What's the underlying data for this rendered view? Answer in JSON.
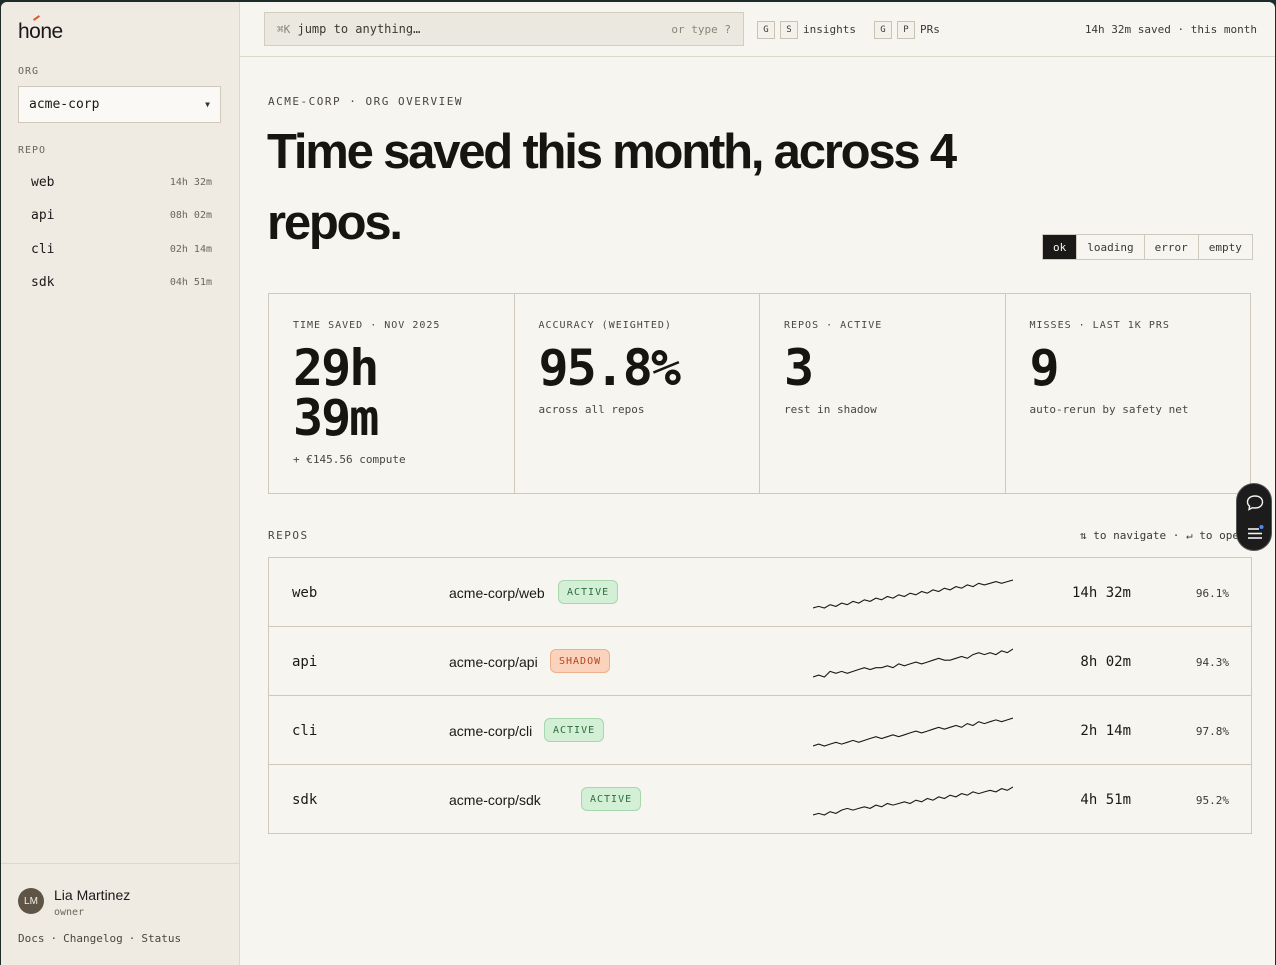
{
  "brand": {
    "name": "hone"
  },
  "sidebar": {
    "org_label": "ORG",
    "org_value": "acme-corp",
    "repo_label": "REPO",
    "repos": [
      {
        "name": "web",
        "time": "14h 32m"
      },
      {
        "name": "api",
        "time": "08h 02m"
      },
      {
        "name": "cli",
        "time": "02h 14m"
      },
      {
        "name": "sdk",
        "time": "04h 51m"
      }
    ],
    "user": {
      "initials": "LM",
      "name": "Lia Martinez",
      "role": "owner"
    },
    "footer_links": [
      "Docs",
      "·",
      "Changelog",
      "·",
      "Status"
    ]
  },
  "topbar": {
    "search_prefix": "⌘K",
    "search_placeholder": "jump to anything…",
    "search_hint": "or type ?",
    "shortcut_insights": {
      "keys": [
        "G",
        "S"
      ],
      "label": "insights"
    },
    "shortcut_prs": {
      "keys": [
        "G",
        "P"
      ],
      "label": "PRs"
    },
    "summary": "14h 32m saved · this month"
  },
  "main": {
    "eyebrow": "ACME-CORP · ORG OVERVIEW",
    "headline": "Time saved this month, across 4 repos.",
    "states": [
      "ok",
      "loading",
      "error",
      "empty"
    ],
    "active_state": "ok",
    "stats": [
      {
        "label": "TIME SAVED · NOV 2025",
        "value": "29h 39m",
        "sub": "+ €145.56 compute"
      },
      {
        "label": "ACCURACY (WEIGHTED)",
        "value": "95.8%",
        "sub": "across all repos"
      },
      {
        "label": "REPOS · ACTIVE",
        "value": "3",
        "sub": "rest in shadow"
      },
      {
        "label": "MISSES · LAST 1K PRS",
        "value": "9",
        "sub": "auto-rerun by safety net"
      }
    ],
    "repos_label": "REPOS",
    "nav_hint": "⇅ to navigate · ↵ to open",
    "rows": [
      {
        "name": "web",
        "path": "acme-corp/web",
        "status": "ACTIVE",
        "status_type": "active",
        "time": "14h 32m",
        "accuracy": "96.1%",
        "spark": [
          2,
          3,
          2,
          4,
          3,
          5,
          4,
          6,
          5,
          7,
          6,
          8,
          7,
          9,
          8,
          10,
          9,
          11,
          10,
          12,
          11,
          13,
          12,
          14,
          13,
          15,
          14,
          16,
          15,
          17,
          16,
          17,
          18,
          17,
          18,
          19
        ]
      },
      {
        "name": "api",
        "path": "acme-corp/api",
        "status": "SHADOW",
        "status_type": "shadow",
        "time": "8h 02m",
        "accuracy": "94.3%",
        "spark": [
          3,
          4,
          3,
          6,
          5,
          6,
          5,
          6,
          7,
          8,
          7,
          8,
          8,
          9,
          8,
          10,
          9,
          10,
          11,
          10,
          11,
          12,
          13,
          12,
          12,
          13,
          14,
          13,
          15,
          16,
          15,
          16,
          15,
          17,
          16,
          18
        ]
      },
      {
        "name": "cli",
        "path": "acme-corp/cli",
        "status": "ACTIVE",
        "status_type": "active",
        "time": "2h 14m",
        "accuracy": "97.8%",
        "spark": [
          3,
          4,
          3,
          4,
          5,
          4,
          5,
          6,
          5,
          6,
          7,
          8,
          7,
          8,
          9,
          8,
          9,
          10,
          11,
          10,
          11,
          12,
          13,
          12,
          13,
          14,
          13,
          15,
          14,
          16,
          15,
          16,
          17,
          16,
          17,
          18
        ]
      },
      {
        "name": "sdk",
        "path": "acme-corp/sdk",
        "status": "ACTIVE",
        "status_type": "active",
        "time": "4h 51m",
        "accuracy": "95.2%",
        "spark": [
          2,
          3,
          2,
          4,
          3,
          5,
          6,
          5,
          6,
          7,
          6,
          8,
          7,
          9,
          8,
          9,
          10,
          9,
          11,
          10,
          12,
          11,
          13,
          12,
          14,
          13,
          15,
          14,
          16,
          15,
          16,
          17,
          16,
          18,
          17,
          19
        ]
      }
    ]
  },
  "colors": {
    "accent": "#e0542a",
    "active_badge": "#d3efd6",
    "shadow_badge": "#fbd3bd",
    "ink": "#1a1917"
  },
  "icons": {
    "chat": "chat-bubble-icon",
    "menu": "list-menu-icon",
    "dropdown": "caret-down-icon"
  }
}
